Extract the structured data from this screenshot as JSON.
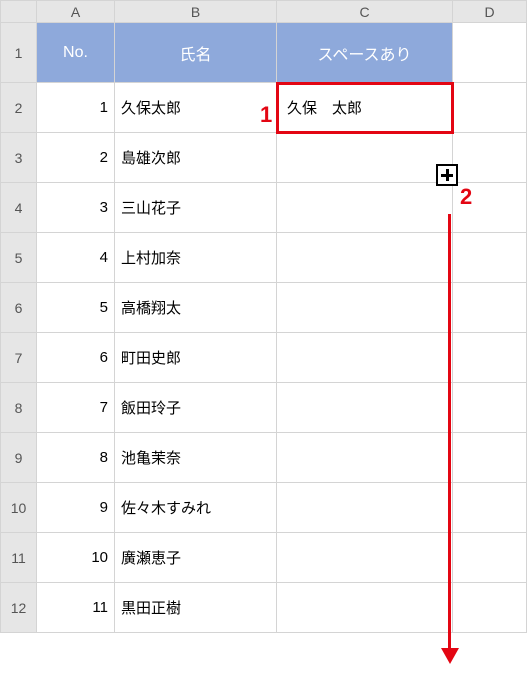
{
  "columns": {
    "A": "A",
    "B": "B",
    "C": "C",
    "D": "D"
  },
  "row_numbers": [
    "1",
    "2",
    "3",
    "4",
    "5",
    "6",
    "7",
    "8",
    "9",
    "10",
    "11",
    "12"
  ],
  "header_row": {
    "A": "No.",
    "B": "氏名",
    "C": "スペースあり"
  },
  "rows": [
    {
      "no": "1",
      "name": "久保太郎",
      "spaced": "久保　太郎"
    },
    {
      "no": "2",
      "name": "島雄次郎",
      "spaced": ""
    },
    {
      "no": "3",
      "name": "三山花子",
      "spaced": ""
    },
    {
      "no": "4",
      "name": "上村加奈",
      "spaced": ""
    },
    {
      "no": "5",
      "name": "高橋翔太",
      "spaced": ""
    },
    {
      "no": "6",
      "name": "町田史郎",
      "spaced": ""
    },
    {
      "no": "7",
      "name": "飯田玲子",
      "spaced": ""
    },
    {
      "no": "8",
      "name": "池亀茉奈",
      "spaced": ""
    },
    {
      "no": "9",
      "name": "佐々木すみれ",
      "spaced": ""
    },
    {
      "no": "10",
      "name": "廣瀬恵子",
      "spaced": ""
    },
    {
      "no": "11",
      "name": "黒田正樹",
      "spaced": ""
    }
  ],
  "annotations": {
    "label1": "1",
    "label2": "2"
  },
  "colors": {
    "header_bg": "#8ea9db",
    "accent": "#e30613"
  }
}
